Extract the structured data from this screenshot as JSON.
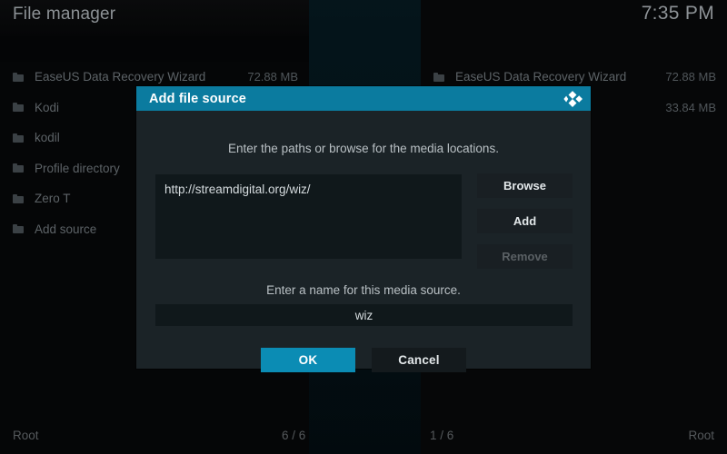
{
  "header": {
    "title": "File manager",
    "clock": "7:35 PM"
  },
  "panes": {
    "left": {
      "items": [
        {
          "icon": "folder-icon",
          "label": "EaseUS Data Recovery Wizard",
          "size": "72.88 MB"
        },
        {
          "icon": "folder-icon",
          "label": "Kodi",
          "size": ""
        },
        {
          "icon": "folder-icon",
          "label": "kodil",
          "size": ""
        },
        {
          "icon": "folder-icon",
          "label": "Profile directory",
          "size": ""
        },
        {
          "icon": "folder-icon",
          "label": "Zero T",
          "size": ""
        },
        {
          "icon": "folder-icon",
          "label": "Add source",
          "size": ""
        }
      ]
    },
    "right": {
      "items": [
        {
          "icon": "folder-icon",
          "label": "EaseUS Data Recovery Wizard",
          "size": "72.88 MB"
        },
        {
          "icon": "folder-icon",
          "label": "",
          "size": "33.84 MB"
        }
      ]
    }
  },
  "statusbar": {
    "left_path": "Root",
    "left_count": "6 / 6",
    "right_count": "1 / 6",
    "right_path": "Root"
  },
  "dialog": {
    "title": "Add file source",
    "logo_icon": "kodi-logo-icon",
    "hint_paths": "Enter the paths or browse for the media locations.",
    "paths": [
      "http://streamdigital.org/wiz/"
    ],
    "side_buttons": [
      {
        "label": "Browse",
        "enabled": true
      },
      {
        "label": "Add",
        "enabled": true
      },
      {
        "label": "Remove",
        "enabled": false
      }
    ],
    "hint_name": "Enter a name for this media source.",
    "name_value": "wiz",
    "actions": [
      {
        "label": "OK",
        "style": "primary"
      },
      {
        "label": "Cancel",
        "style": "secondary"
      }
    ]
  },
  "colors": {
    "accent": "#0b7b9f",
    "accent_button": "#0b8cb4",
    "dialog_bg": "#1b2327",
    "input_bg": "#10181b",
    "page_bg": "#050607",
    "text_dim": "#5d6367",
    "text_bright": "#d6dcdf"
  }
}
